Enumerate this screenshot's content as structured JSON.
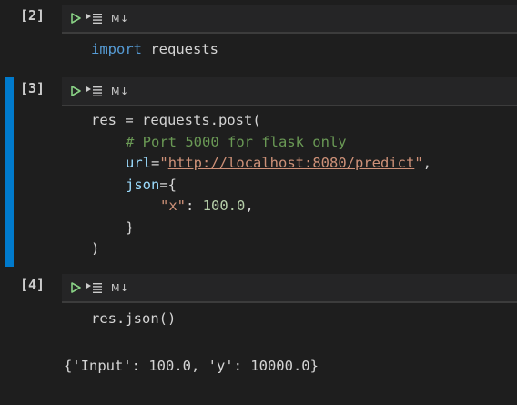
{
  "cells": [
    {
      "exec_count": "[2]",
      "toolbar": {
        "md_label": "M↓"
      },
      "code": {
        "line1_kw": "import",
        "line1_rest": " requests"
      }
    },
    {
      "exec_count": "[3]",
      "toolbar": {
        "md_label": "M↓"
      },
      "code": {
        "l1_a": "res ",
        "l1_op": "=",
        "l1_b": " requests.post(",
        "l2": "# Port 5000 for flask only",
        "l3_param": "url",
        "l3_eq": "=",
        "l3_q1": "\"",
        "l3_url": "http://localhost:8080/predict",
        "l3_q2": "\"",
        "l3_comma": ",",
        "l4_param": "json",
        "l4_rest": "={",
        "l5_key": "\"x\"",
        "l5_colon": ": ",
        "l5_num": "100.0",
        "l5_comma": ",",
        "l6": "}",
        "l7": ")"
      }
    },
    {
      "exec_count": "[4]",
      "toolbar": {
        "md_label": "M↓"
      },
      "code": {
        "line1": "res.json()"
      },
      "output": "{'Input': 100.0, 'y': 10000.0}"
    }
  ]
}
